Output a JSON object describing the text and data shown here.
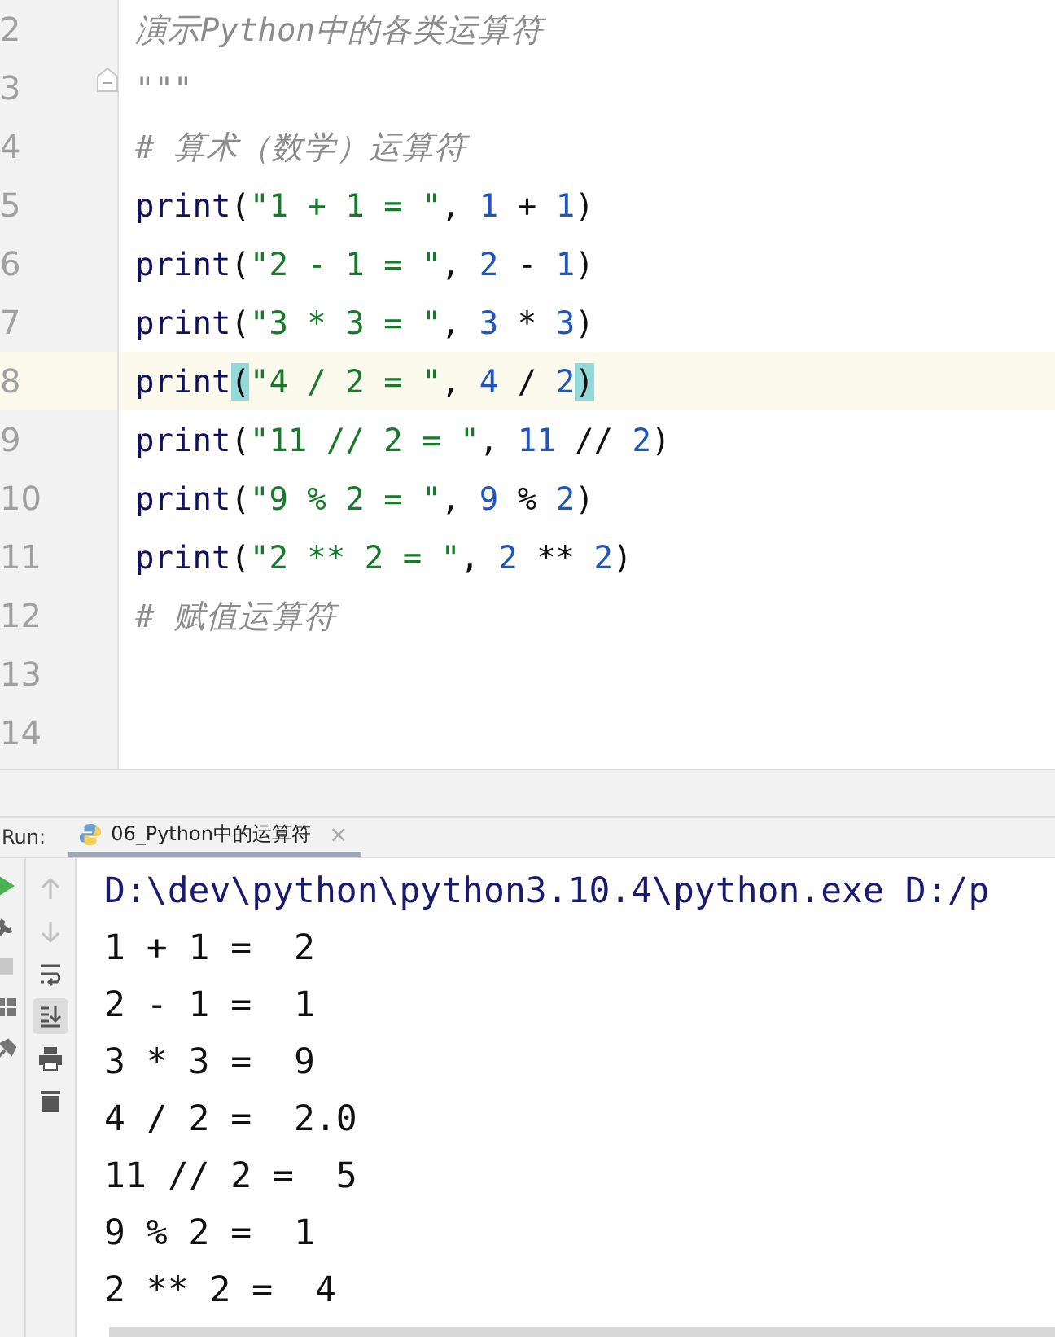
{
  "editor": {
    "lines": [
      {
        "number": "2",
        "fold": false,
        "tokens": [
          {
            "kind": "doc",
            "text": "演示Python中的各类运算符"
          }
        ]
      },
      {
        "number": "3",
        "fold": true,
        "tokens": [
          {
            "kind": "doc",
            "text": "\"\"\""
          }
        ]
      },
      {
        "number": "4",
        "fold": false,
        "tokens": [
          {
            "kind": "comment",
            "text": "# 算术（数学）运算符"
          }
        ]
      },
      {
        "number": "5",
        "fold": false,
        "tokens": [
          {
            "kind": "func",
            "text": "print"
          },
          {
            "kind": "plain",
            "text": "("
          },
          {
            "kind": "str",
            "text": "\"1 + 1 = \""
          },
          {
            "kind": "plain",
            "text": ", "
          },
          {
            "kind": "num",
            "text": "1"
          },
          {
            "kind": "plain",
            "text": " + "
          },
          {
            "kind": "num",
            "text": "1"
          },
          {
            "kind": "plain",
            "text": ")"
          }
        ]
      },
      {
        "number": "6",
        "fold": false,
        "tokens": [
          {
            "kind": "func",
            "text": "print"
          },
          {
            "kind": "plain",
            "text": "("
          },
          {
            "kind": "str",
            "text": "\"2 - 1 = \""
          },
          {
            "kind": "plain",
            "text": ", "
          },
          {
            "kind": "num",
            "text": "2"
          },
          {
            "kind": "plain",
            "text": " - "
          },
          {
            "kind": "num",
            "text": "1"
          },
          {
            "kind": "plain",
            "text": ")"
          }
        ]
      },
      {
        "number": "7",
        "fold": false,
        "tokens": [
          {
            "kind": "func",
            "text": "print"
          },
          {
            "kind": "plain",
            "text": "("
          },
          {
            "kind": "str",
            "text": "\"3 * 3 = \""
          },
          {
            "kind": "plain",
            "text": ", "
          },
          {
            "kind": "num",
            "text": "3"
          },
          {
            "kind": "plain",
            "text": " * "
          },
          {
            "kind": "num",
            "text": "3"
          },
          {
            "kind": "plain",
            "text": ")"
          }
        ]
      },
      {
        "number": "8",
        "fold": false,
        "current": true,
        "tokens": [
          {
            "kind": "func",
            "text": "print"
          },
          {
            "kind": "plain",
            "text": "(",
            "matched": true
          },
          {
            "kind": "str",
            "text": "\"4 / 2 = \""
          },
          {
            "kind": "plain",
            "text": ", "
          },
          {
            "kind": "num",
            "text": "4"
          },
          {
            "kind": "plain",
            "text": " / "
          },
          {
            "kind": "num",
            "text": "2"
          },
          {
            "kind": "plain",
            "text": ")",
            "matched": true
          }
        ]
      },
      {
        "number": "9",
        "fold": false,
        "tokens": [
          {
            "kind": "func",
            "text": "print"
          },
          {
            "kind": "plain",
            "text": "("
          },
          {
            "kind": "str",
            "text": "\"11 // 2 = \""
          },
          {
            "kind": "plain",
            "text": ", "
          },
          {
            "kind": "num",
            "text": "11"
          },
          {
            "kind": "plain",
            "text": " // "
          },
          {
            "kind": "num",
            "text": "2"
          },
          {
            "kind": "plain",
            "text": ")"
          }
        ]
      },
      {
        "number": "10",
        "fold": false,
        "tokens": [
          {
            "kind": "func",
            "text": "print"
          },
          {
            "kind": "plain",
            "text": "("
          },
          {
            "kind": "str",
            "text": "\"9 % 2 = \""
          },
          {
            "kind": "plain",
            "text": ", "
          },
          {
            "kind": "num",
            "text": "9"
          },
          {
            "kind": "plain",
            "text": " % "
          },
          {
            "kind": "num",
            "text": "2"
          },
          {
            "kind": "plain",
            "text": ")"
          }
        ]
      },
      {
        "number": "11",
        "fold": false,
        "tokens": [
          {
            "kind": "func",
            "text": "print"
          },
          {
            "kind": "plain",
            "text": "("
          },
          {
            "kind": "str",
            "text": "\"2 ** 2 = \""
          },
          {
            "kind": "plain",
            "text": ", "
          },
          {
            "kind": "num",
            "text": "2"
          },
          {
            "kind": "plain",
            "text": " ** "
          },
          {
            "kind": "num",
            "text": "2"
          },
          {
            "kind": "plain",
            "text": ")"
          }
        ]
      },
      {
        "number": "12",
        "fold": false,
        "tokens": [
          {
            "kind": "comment",
            "text": "# 赋值运算符"
          }
        ]
      },
      {
        "number": "13",
        "fold": false
      },
      {
        "number": "14",
        "fold": false
      }
    ]
  },
  "run_panel": {
    "label": "Run:",
    "tab": {
      "title": "06_Python中的运算符",
      "close": "×"
    },
    "side_tools": [
      {
        "kind": "up",
        "selected": false
      },
      {
        "kind": "down",
        "selected": false
      },
      {
        "kind": "wrap",
        "selected": false
      },
      {
        "kind": "scroll_end",
        "selected": true
      },
      {
        "kind": "print",
        "selected": false
      },
      {
        "kind": "trash",
        "selected": false
      }
    ],
    "output": [
      {
        "kind": "command",
        "text": "D:\\dev\\python\\python3.10.4\\python.exe D:/p"
      },
      {
        "kind": "out",
        "text": "1 + 1 =  2"
      },
      {
        "kind": "out",
        "text": "2 - 1 =  1"
      },
      {
        "kind": "out",
        "text": "3 * 3 =  9"
      },
      {
        "kind": "out",
        "text": "4 / 2 =  2.0"
      },
      {
        "kind": "out",
        "text": "11 // 2 =  5"
      },
      {
        "kind": "out",
        "text": "9 % 2 =  1"
      },
      {
        "kind": "out",
        "text": "2 ** 2 =  4"
      }
    ]
  }
}
